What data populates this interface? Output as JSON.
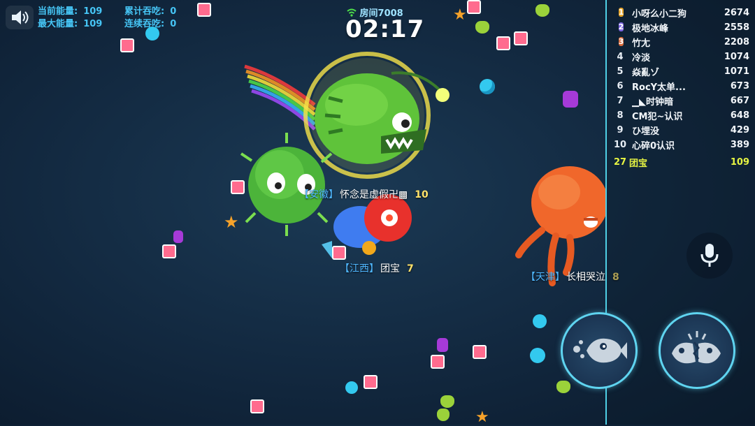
{
  "stats": {
    "current_energy_label": "当前能量:",
    "current_energy_value": "109",
    "max_energy_label": "最大能量:",
    "max_energy_value": "109",
    "total_eaten_label": "累计吞吃:",
    "total_eaten_value": "0",
    "streak_eaten_label": "连续吞吃:",
    "streak_eaten_value": "0"
  },
  "room": {
    "label": "房间7008"
  },
  "timer": {
    "value": "02:17"
  },
  "leaderboard": {
    "rows": [
      {
        "rank": "1",
        "name": "小呀么小二狗",
        "score": "2674",
        "medal_color": "#e8a52a"
      },
      {
        "rank": "2",
        "name": "极地冰峰",
        "score": "2558",
        "medal_color": "#7f67e0"
      },
      {
        "rank": "3",
        "name": "竹尢",
        "score": "2208",
        "medal_color": "#d76a3a"
      },
      {
        "rank": "4",
        "name": "冷淡",
        "score": "1074"
      },
      {
        "rank": "5",
        "name": "焱亂ゾ",
        "score": "1071"
      },
      {
        "rank": "6",
        "name": "RocY太单...",
        "score": "673"
      },
      {
        "rank": "7",
        "name": "▁◣时钟暗",
        "score": "667"
      },
      {
        "rank": "8",
        "name": "CM犯~认识",
        "score": "648"
      },
      {
        "rank": "9",
        "name": "ひ埋没",
        "score": "429"
      },
      {
        "rank": "10",
        "name": "心碎0认识",
        "score": "389"
      }
    ],
    "self": {
      "rank": "27",
      "name": "团宝",
      "score": "109"
    },
    "accent_color": "#e7f542"
  },
  "players": {
    "anhui": {
      "province": "【安徽】",
      "name": "怀念是虚假卍▩",
      "level": "10"
    },
    "jiangxi": {
      "province": "【江西】",
      "name": "团宝",
      "level": "7"
    },
    "tianjin": {
      "province": "【天津】",
      "name": "长相哭泣",
      "level": "8"
    }
  },
  "icons": {
    "speaker": "speaker-icon",
    "wifi": "wifi-icon",
    "mic": "microphone-icon",
    "dash": "dash-fish-icon",
    "split": "split-fish-icon"
  },
  "colors": {
    "stat_text": "#46c5f5",
    "board_border": "#4fd0e6",
    "button_ring": "#5fd4f0"
  }
}
